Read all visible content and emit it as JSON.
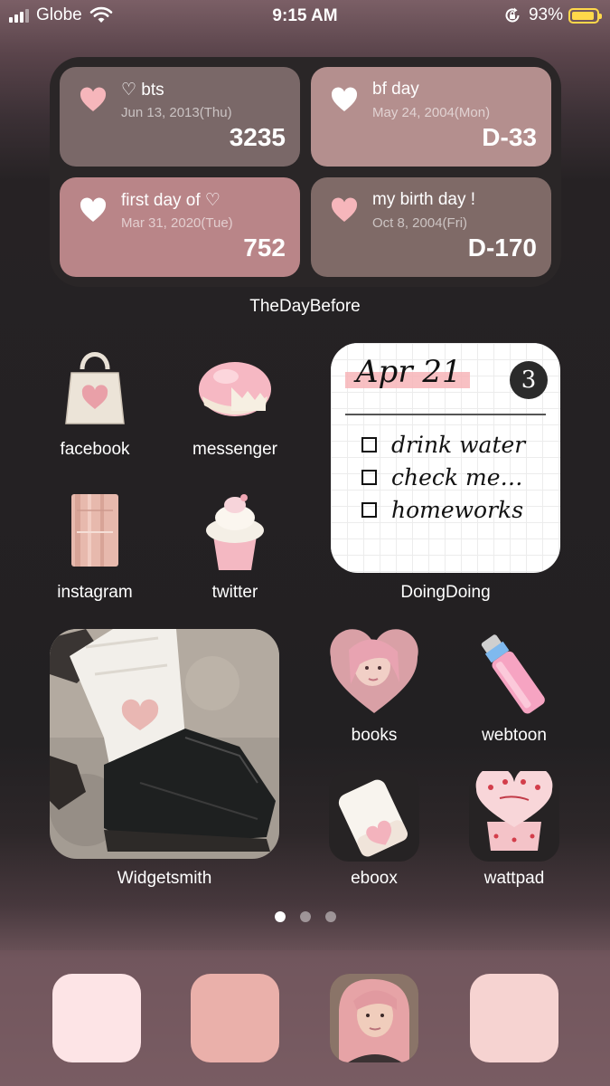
{
  "status_bar": {
    "carrier": "Globe",
    "time": "9:15 AM",
    "battery_percent": "93%",
    "battery_level": 0.93,
    "battery_color": "#ffd84a"
  },
  "thedaybefore": {
    "label": "TheDayBefore",
    "cards": [
      {
        "title": "♡ bts",
        "date": "Jun 13, 2013(Thu)",
        "count": "3235",
        "heart_color": "#f6b6bb"
      },
      {
        "title": "bf day",
        "date": "May 24, 2004(Mon)",
        "count": "D-33",
        "heart_color": "#ffffff"
      },
      {
        "title": "first day of ♡",
        "date": "Mar 31, 2020(Tue)",
        "count": "752",
        "heart_color": "#ffffff"
      },
      {
        "title": "my birth day !",
        "date": "Oct 8, 2004(Fri)",
        "count": "D-170",
        "heart_color": "#f6b6bb"
      }
    ]
  },
  "apps": {
    "facebook": "facebook",
    "messenger": "messenger",
    "instagram": "instagram",
    "twitter": "twitter",
    "books": "books",
    "webtoon": "webtoon",
    "eboox": "eboox",
    "wattpad": "wattpad"
  },
  "doingdoing": {
    "label": "DoingDoing",
    "date": "Apr 21",
    "count": "3",
    "todos": [
      "drink water",
      "check me…",
      "homeworks"
    ]
  },
  "widgetsmith": {
    "label": "Widgetsmith"
  },
  "page_dots": {
    "count": 3,
    "active_index": 0
  },
  "dock": {
    "colors": [
      "#fde4e6",
      "#eab0aa",
      "photo",
      "#f6d3d1"
    ]
  }
}
